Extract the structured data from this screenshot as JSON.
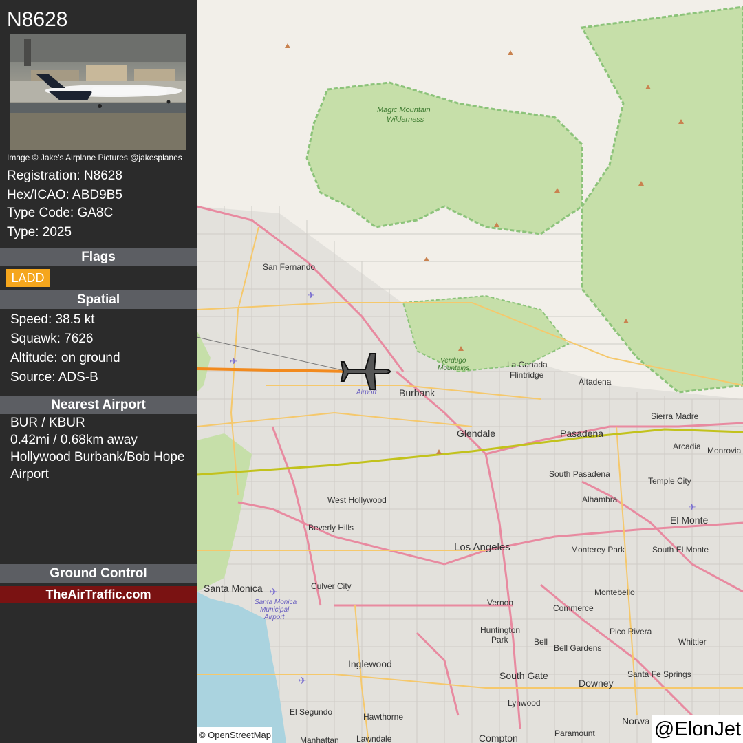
{
  "aircraft": {
    "registration_title": "N8628",
    "photo_credit": "Image © Jake's Airplane Pictures @jakesplanes",
    "details": [
      "Registration: N8628",
      "Hex/ICAO: ABD9B5",
      "Type Code: GA8C",
      "Type: 2025"
    ]
  },
  "sections": {
    "flags_title": "Flags",
    "spatial_title": "Spatial",
    "nearest_title": "Nearest Airport",
    "ground_title": "Ground Control"
  },
  "flags": [
    "LADD"
  ],
  "spatial": [
    "Speed: 38.5 kt",
    "Squawk: 7626",
    "Altitude: on ground",
    "Source: ADS-B"
  ],
  "nearest_airport": {
    "code": "BUR / KBUR",
    "distance": "0.42mi / 0.68km away",
    "name_line1": "Hollywood Burbank/Bob Hope",
    "name_line2": "Airport"
  },
  "promo": "TheAirTraffic.com",
  "map": {
    "attribution": "© OpenStreetMap",
    "watermark": "@ElonJet",
    "places": {
      "magic_mountain_1": "Magic Mountain",
      "magic_mountain_2": "Wilderness",
      "san_fernando": "San Fernando",
      "burbank": "Burbank",
      "burbank_airport": "Airport",
      "verdugo_1": "Verdugo",
      "verdugo_2": "Mountains",
      "la_canada_1": "La Canada",
      "la_canada_2": "Flintridge",
      "altadena": "Altadena",
      "sierra_madre": "Sierra Madre",
      "monrovia": "Monrovia",
      "arcadia": "Arcadia",
      "glendale": "Glendale",
      "pasadena": "Pasadena",
      "south_pasadena": "South Pasadena",
      "temple_city": "Temple City",
      "west_hollywood": "West Hollywood",
      "alhambra": "Alhambra",
      "el_monte": "El Monte",
      "beverly_hills": "Beverly Hills",
      "los_angeles": "Los Angeles",
      "monterey_park": "Monterey Park",
      "south_el_monte": "South El Monte",
      "santa_monica": "Santa Monica",
      "culver_city": "Culver City",
      "sm_airport_1": "Santa Monica",
      "sm_airport_2": "Municipal",
      "sm_airport_3": "Airport",
      "montebello": "Montebello",
      "vernon": "Vernon",
      "commerce": "Commerce",
      "huntington_1": "Huntington",
      "huntington_2": "Park",
      "bell": "Bell",
      "bell_gardens": "Bell Gardens",
      "pico_rivera": "Pico Rivera",
      "whittier": "Whittier",
      "inglewood": "Inglewood",
      "south_gate": "South Gate",
      "downey": "Downey",
      "santa_fe_springs": "Santa Fe Springs",
      "lynwood": "Lynwood",
      "el_segundo": "El Segundo",
      "hawthorne": "Hawthorne",
      "norwalk": "Norwa",
      "paramount": "Paramount",
      "compton": "Compton",
      "lawndale": "Lawndale",
      "manhattan": "Manhattan"
    },
    "colors": {
      "forest": "#c6dfa9",
      "forest_border": "#8cc37a",
      "urban": "#dedcd6",
      "water": "#aad3df",
      "track_orange": "#f28a1e",
      "track_yellowgreen": "#c2c21c",
      "motorway": "#e88aa0",
      "trunk": "#f5c86c"
    }
  }
}
